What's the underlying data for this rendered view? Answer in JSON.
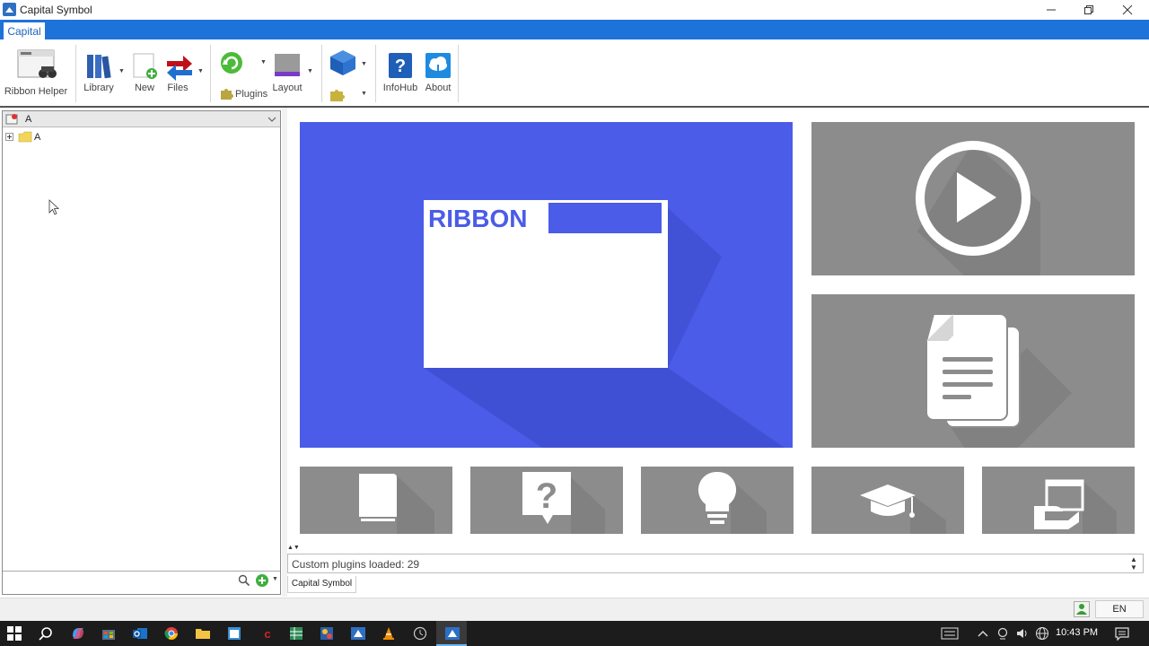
{
  "window": {
    "title": "Capital Symbol"
  },
  "ribbon": {
    "tab": "Capital",
    "buttons": {
      "ribbon_helper": "Ribbon Helper",
      "library": "Library",
      "new": "New",
      "files": "Files",
      "plugins": "Plugins",
      "layout": "Layout",
      "infohub": "InfoHub",
      "about": "About"
    }
  },
  "left_pane": {
    "combo_value": "A",
    "tree": [
      {
        "label": "A"
      }
    ]
  },
  "tiles": {
    "main_text": "RIBBON"
  },
  "status": {
    "message": "Custom plugins loaded: 29",
    "tab": "Capital Symbol",
    "language": "EN"
  },
  "taskbar": {
    "time": "10:43 PM"
  },
  "colors": {
    "accent": "#1e73d8",
    "main_tile": "#4a5ce8",
    "tile_gray": "#8c8c8c"
  }
}
